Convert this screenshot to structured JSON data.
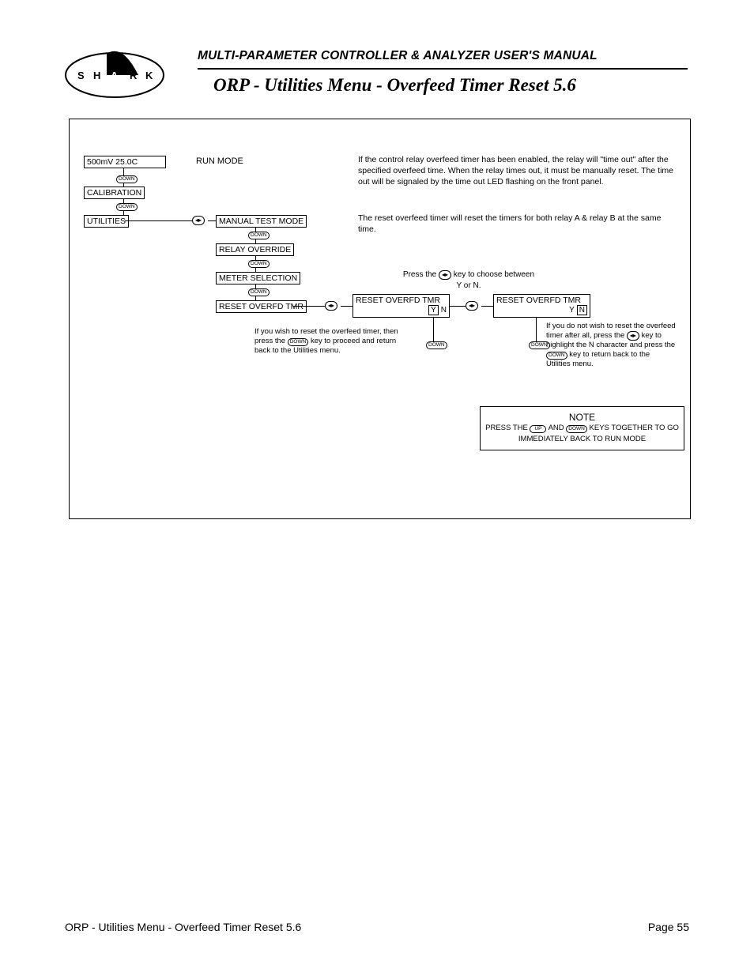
{
  "logo_letters": [
    "S",
    "H",
    "A",
    "R",
    "K"
  ],
  "header": {
    "subtitle": "MULTI-PARAMETER CONTROLLER & ANALYZER USER'S MANUAL",
    "title": "ORP - Utilities Menu - Overfeed Timer Reset 5.6"
  },
  "menu": {
    "display": "500mV  25.0C",
    "run_label": "RUN MODE",
    "calibration": "CALIBRATION",
    "utilities": "UTILITIES",
    "manual_test": "MANUAL TEST MODE",
    "relay_override": "RELAY OVERRIDE",
    "meter_selection": "METER SELECTION",
    "reset_tmr": "RESET OVERFD TMR"
  },
  "keys": {
    "down": "DOWN",
    "up": "UP",
    "lr": "◂▸"
  },
  "screens": {
    "yn_title": "RESET OVERFD TMR",
    "y": "Y",
    "n": "N"
  },
  "desc": {
    "p1": "If the control relay overfeed timer has been enabled, the relay will \"time out\" after the specified overfeed time. When the relay times out, it must be manually reset. The time out will be signaled by the time out LED flashing on the front panel.",
    "p2": "The reset overfeed timer will reset the timers for both relay A & relay B at the same time.",
    "choose_pre": "Press the",
    "choose_post": "key to choose between Y or N.",
    "yes_pre": "If you wish to reset the overfeed timer, then press the",
    "yes_post": "key to proceed and return back to the Utilities menu.",
    "no_pre": "If you do not wish to reset the overfeed timer after all, press the",
    "no_mid": "key to highlight the N character and press the",
    "no_post": "key to return back to the Utilities menu."
  },
  "note": {
    "title": "NOTE",
    "pre": "PRESS THE",
    "mid": "AND",
    "post": "KEYS TOGETHER TO GO IMMEDIATELY BACK TO RUN MODE"
  },
  "footer": {
    "left": "ORP - Utilities Menu - Overfeed Timer Reset 5.6",
    "right": "Page 55"
  }
}
